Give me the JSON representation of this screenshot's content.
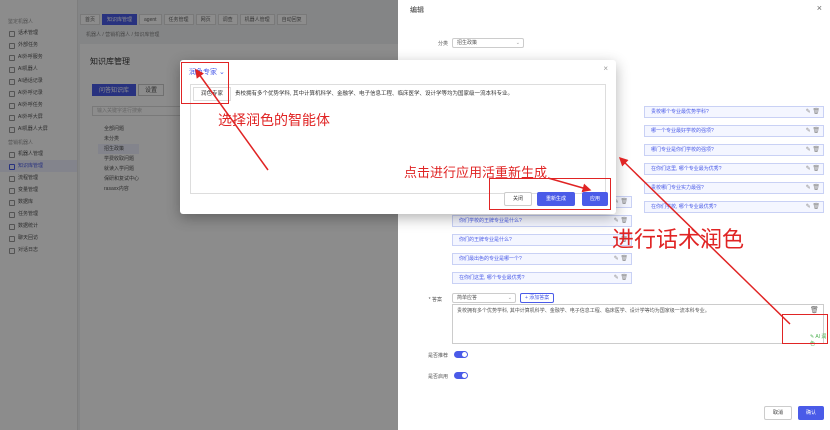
{
  "sidebar": {
    "group1": "鉴定机器人",
    "items": [
      "话术管理",
      "外部任务",
      "AI外呼服务",
      "AI机器人",
      "AI通话记录",
      "AI外呼记录",
      "AI外呼任务",
      "AI外呼大屏",
      "AI机器人大屏"
    ],
    "group2": "营销机器人",
    "items2": [
      "机器人管理",
      "知识库管理",
      "流程管理",
      "变量管理",
      "数据库",
      "任务管理",
      "数据统计",
      "聊天回访",
      "对话日志"
    ]
  },
  "tabs": [
    "首页",
    "知识库管理",
    "agent",
    "任务管理",
    "网页",
    "调查",
    "机器人管理",
    "自动回复"
  ],
  "breadcrumb": "机器人 / 营销机器人 / 知识库管理",
  "main": {
    "title": "知识库管理",
    "tab_qa": "问答知识库",
    "tab_settings": "设置",
    "search_placeholder": "输入关键字进行搜索",
    "tree": [
      "全部问题",
      "未分类",
      "招生政策",
      "学费收取问题",
      "就读入学问题",
      "保研和复试中心",
      "rasaxx内容"
    ]
  },
  "drawer": {
    "title": "编辑",
    "category_label": "分类",
    "category_value": "招生政策",
    "questions": [
      "贵校哪个专业最优势学科?",
      "哪一个专业最好学校的强项?",
      "哪门专业是你们学校的强项?",
      "在你们这里, 哪个专业最为优秀?",
      "贵校哪门专业实力最强?",
      "在你们学校, 哪个专业最优秀?",
      "哪一个专业最受欢迎?",
      "你们学校的王牌专业是什么?",
      "你们的王牌专业是什么?",
      "你们最出色的专业是哪一个?",
      "在你们这里, 哪个专业最优秀?"
    ],
    "answer_label": "答案",
    "answer_type": "简单应答",
    "add_answer": "+ 添加答案",
    "answer_text": "贵校拥有多个优势学科, 其中计算机科学、金融学、电子信息工程、临床医学、设计学等均为国家级一流本科专业。",
    "ai_polish": "AI 润色",
    "recommend_label": "是否推荐",
    "enable_label": "是否启用",
    "cancel": "取消",
    "confirm": "确认"
  },
  "modal": {
    "title": "润色专家",
    "expert_tab": "润色专家",
    "text": "贵校拥有多个优势学科, 其中计算机科学、金融学、电子信息工程、临床医学、设计学等均为国家级一流本科专业。",
    "close": "关闭",
    "regenerate": "重新生成",
    "apply": "应用"
  },
  "annotations": {
    "select_agent": "选择润色的智能体",
    "apply_hint": "点击进行应用活重新生成",
    "polish": "进行话术润色"
  },
  "colors": {
    "primary": "#4a5be8",
    "annotation": "#e02424"
  }
}
